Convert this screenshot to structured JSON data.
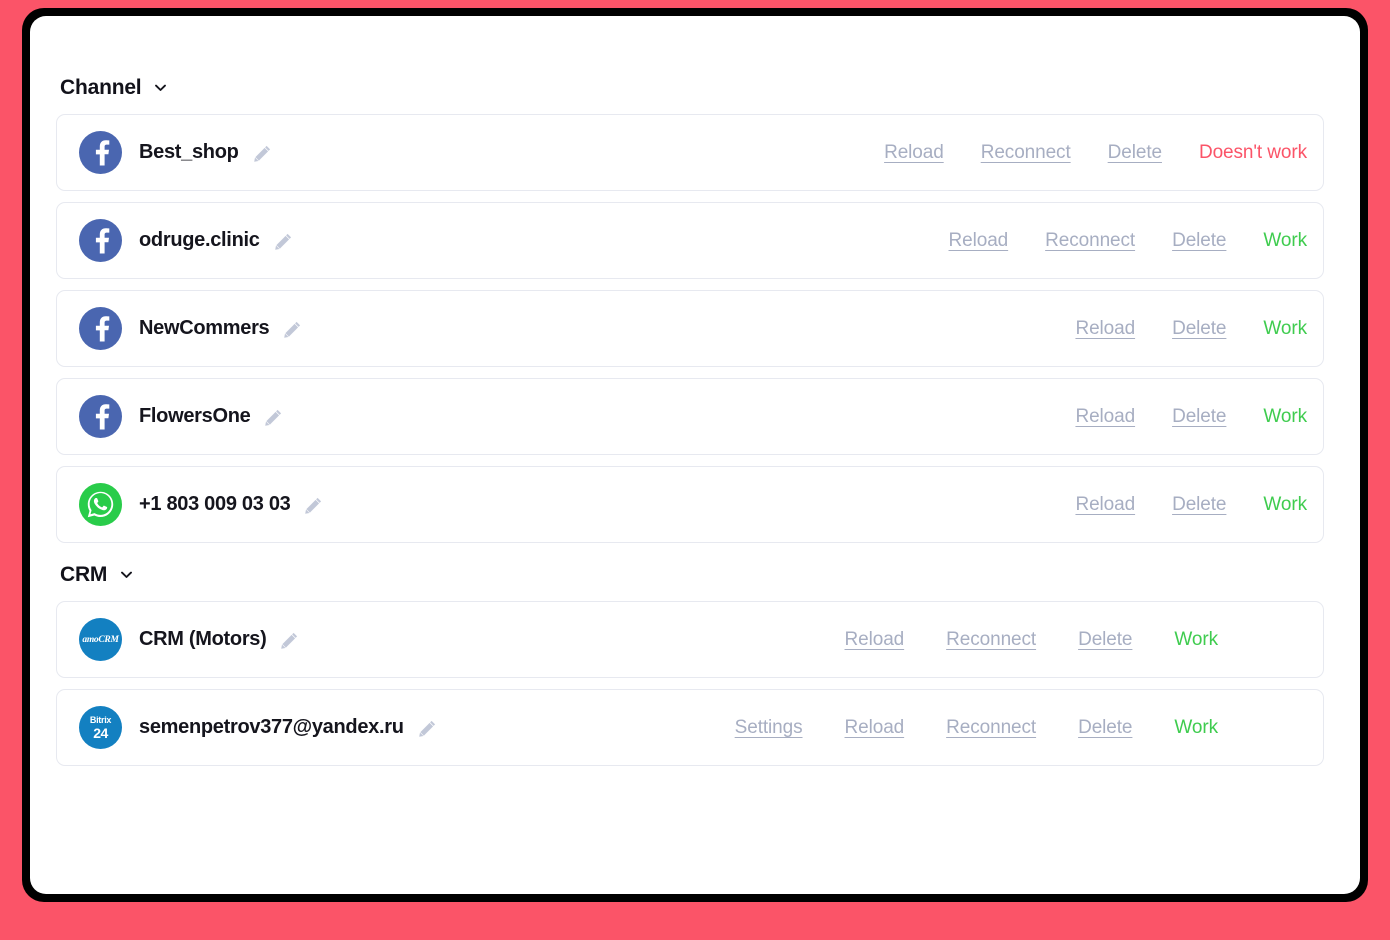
{
  "theme": {
    "accent_red": "#fb5468",
    "accent_green": "#3fcc4f",
    "link_grey": "#a7aec2",
    "facebook_blue": "#4a66b0",
    "whatsapp_green": "#29cc4a",
    "crm_blue": "#1380c1"
  },
  "sections": [
    {
      "id": "channel",
      "title": "Channel",
      "chevron_icon": "chevron-down-icon",
      "rows": [
        {
          "id": "best-shop",
          "provider": "facebook",
          "provider_icon": "facebook-icon",
          "title": "Best_shop",
          "edit_icon": "pencil-icon",
          "actions": [
            "Reload",
            "Reconnect",
            "Delete"
          ],
          "status": "Doesn't work",
          "status_state": "broken"
        },
        {
          "id": "odruge-clinic",
          "provider": "facebook",
          "provider_icon": "facebook-icon",
          "title": "odruge.clinic",
          "edit_icon": "pencil-icon",
          "actions": [
            "Reload",
            "Reconnect",
            "Delete"
          ],
          "status": "Work",
          "status_state": "work"
        },
        {
          "id": "newcommers",
          "provider": "facebook",
          "provider_icon": "facebook-icon",
          "title": "NewCommers",
          "edit_icon": "pencil-icon",
          "actions": [
            "Reload",
            "Delete"
          ],
          "status": "Work",
          "status_state": "work"
        },
        {
          "id": "flowersone",
          "provider": "facebook",
          "provider_icon": "facebook-icon",
          "title": "FlowersOne",
          "edit_icon": "pencil-icon",
          "actions": [
            "Reload",
            "Delete"
          ],
          "status": "Work",
          "status_state": "work"
        },
        {
          "id": "whatsapp-number",
          "provider": "whatsapp",
          "provider_icon": "whatsapp-icon",
          "title": "+1 803 009 03 03",
          "edit_icon": "pencil-icon",
          "actions": [
            "Reload",
            "Delete"
          ],
          "status": "Work",
          "status_state": "work"
        }
      ]
    },
    {
      "id": "crm",
      "title": "CRM",
      "chevron_icon": "chevron-down-icon",
      "rows": [
        {
          "id": "crm-motors",
          "provider": "amocrm",
          "provider_icon": "amocrm-icon",
          "provider_label": "amoCRM",
          "title": "CRM (Motors)",
          "edit_icon": "pencil-icon",
          "actions": [
            "Reload",
            "Reconnect",
            "Delete"
          ],
          "status": "Work",
          "status_state": "work"
        },
        {
          "id": "bitrix24-account",
          "provider": "bitrix24",
          "provider_icon": "bitrix24-icon",
          "provider_label_top": "Bitrix",
          "provider_label_bottom": "24",
          "title": "semenpetrov377@yandex.ru",
          "edit_icon": "pencil-icon",
          "actions": [
            "Settings",
            "Reload",
            "Reconnect",
            "Delete"
          ],
          "status": "Work",
          "status_state": "work"
        }
      ]
    }
  ]
}
